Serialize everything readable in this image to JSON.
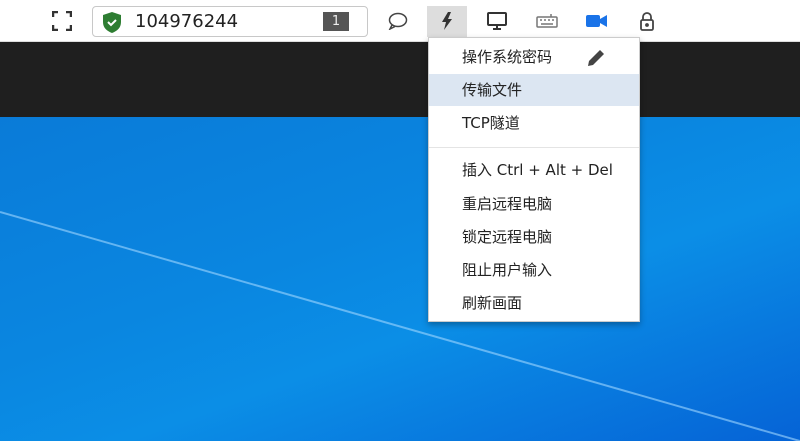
{
  "toolbar": {
    "session_id": "104976244",
    "badge_count": "1",
    "icons": [
      "fullscreen-icon",
      "shield-check-icon",
      "chat-icon",
      "flash-icon",
      "monitor-icon",
      "keyboard-icon",
      "video-camera-icon",
      "lock-icon"
    ]
  },
  "menu": {
    "items": [
      {
        "label": "操作系统密码",
        "icon": "pencil-icon"
      },
      {
        "label": "传输文件"
      },
      {
        "label": "TCP隧道"
      },
      {
        "label": "插入 Ctrl + Alt + Del"
      },
      {
        "label": "重启远程电脑"
      },
      {
        "label": "锁定远程电脑"
      },
      {
        "label": "阻止用户输入"
      },
      {
        "label": "刷新画面"
      }
    ]
  },
  "colors": {
    "shield": "#2e7d32",
    "video": "#1a73e8",
    "highlight": "#dce6f2",
    "dark_bar": "#1f1f1f"
  }
}
